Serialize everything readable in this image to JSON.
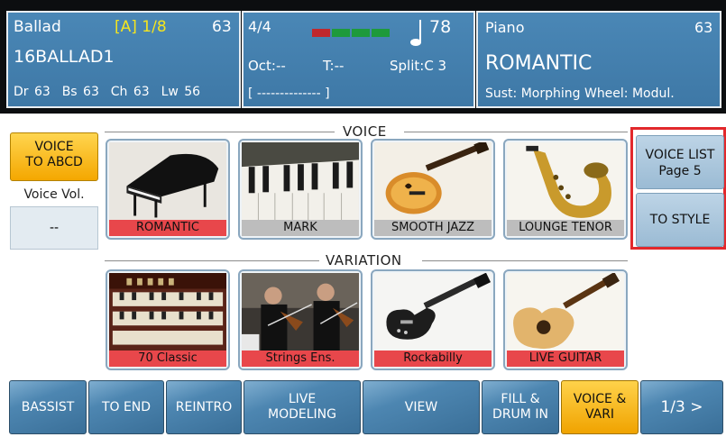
{
  "header": {
    "style_name": "Ballad",
    "section": "[A] 1/8",
    "style_volume": "63",
    "style_file": "16BALLAD1",
    "parts": "Dr 63  Bs 63  Ch 63  Lw 56",
    "time_signature": "4/4",
    "tempo": "78",
    "octave": "Oct:--",
    "transpose": "T:--",
    "split": "Split:C 3",
    "chord": "[ -------------- ]",
    "voice_category": "Piano",
    "voice_volume": "63",
    "voice_name": "ROMANTIC",
    "controls": "Sust: Morphing Wheel: Modul.",
    "meter_colors": [
      "#c0282d",
      "#1e9a3b",
      "#1e9a3b",
      "#1e9a3b"
    ]
  },
  "voice_section": {
    "title": "VOICE",
    "to_abcd_label": "VOICE\nTO ABCD",
    "voice_vol_label": "Voice Vol.",
    "voice_vol_value": "--",
    "cards": [
      {
        "label": "ROMANTIC",
        "selected": true,
        "icon": "grand-piano"
      },
      {
        "label": "MARK",
        "selected": false,
        "icon": "electric-piano"
      },
      {
        "label": "SMOOTH JAZZ",
        "selected": false,
        "icon": "jazz-guitar"
      },
      {
        "label": "LOUNGE TENOR",
        "selected": false,
        "icon": "saxophone"
      }
    ]
  },
  "variation_section": {
    "title": "VARIATION",
    "cards": [
      {
        "label": "70 Classic",
        "icon": "organ"
      },
      {
        "label": "Strings Ens.",
        "icon": "string-ensemble"
      },
      {
        "label": "Rockabilly",
        "icon": "electric-guitar"
      },
      {
        "label": "LIVE GUITAR",
        "icon": "acoustic-guitar"
      }
    ]
  },
  "right_buttons": {
    "voice_list": "VOICE LIST\nPage 5",
    "to_style": "TO STYLE"
  },
  "bottom_bar": [
    {
      "label": "BASSIST",
      "active": false
    },
    {
      "label": "TO END",
      "active": false
    },
    {
      "label": "REINTRO",
      "active": false
    },
    {
      "label": "LIVE\nMODELING",
      "active": false
    },
    {
      "label": "VIEW",
      "active": false
    },
    {
      "label": "FILL &\nDRUM IN",
      "active": false
    },
    {
      "label": "VOICE &\nVARI",
      "active": true
    },
    {
      "label": "1/3 >",
      "active": false
    }
  ]
}
